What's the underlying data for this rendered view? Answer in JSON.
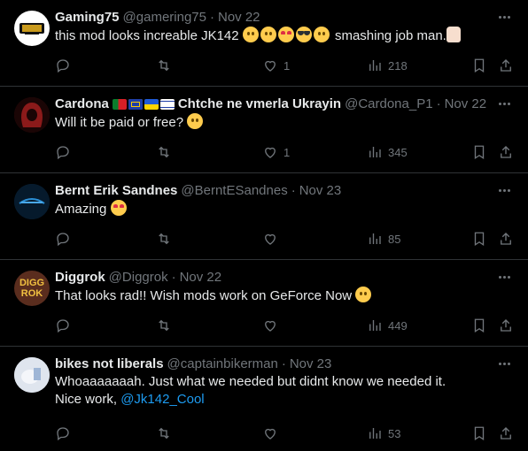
{
  "replies": [
    {
      "name": "Gaming75",
      "handle": "@gamering75",
      "time": "Nov 22",
      "text_before": "this mod looks increable JK142 ",
      "text_after": " smashing job man.",
      "likes": "1",
      "views": "218",
      "avatar_color": "#ffffff"
    },
    {
      "name": "Cardona",
      "name_suffix": "Chtche ne vmerla Ukrayin",
      "handle": "@Cardona_P1",
      "time": "Nov 22",
      "text_before": "Will it be paid or free? ",
      "likes": "1",
      "views": "345",
      "avatar_color": "#3a0d0d"
    },
    {
      "name": "Bernt Erik Sandnes",
      "handle": "@BerntESandnes",
      "time": "Nov 23",
      "text_before": "Amazing ",
      "likes": "",
      "views": "85",
      "avatar_color": "#0a2a44"
    },
    {
      "name": "Diggrok",
      "handle": "@Diggrok",
      "time": "Nov 22",
      "text_before": "That looks rad!! Wish mods work on GeForce Now ",
      "likes": "",
      "views": "449",
      "avatar_color": "#5a2d1e",
      "avatar_text_1": "DIGG",
      "avatar_text_2": "ROK"
    },
    {
      "name": "bikes not liberals",
      "handle": "@captainbikerman",
      "time": "Nov 23",
      "text_line1": "Whoaaaaaaah. Just what we needed but didnt know we needed it.",
      "text_line2_before": "Nice work, ",
      "mention": "@Jk142_Cool",
      "likes": "",
      "views": "53",
      "avatar_color": "#d8dde6"
    }
  ],
  "colors": {
    "background": "#000000",
    "text": "#e7e9ea",
    "muted": "#71767b",
    "link": "#1d9bf0",
    "divider": "#2f3336"
  },
  "icons": [
    "reply-icon",
    "retweet-icon",
    "like-icon",
    "views-icon",
    "bookmark-icon",
    "share-icon",
    "more-icon"
  ]
}
